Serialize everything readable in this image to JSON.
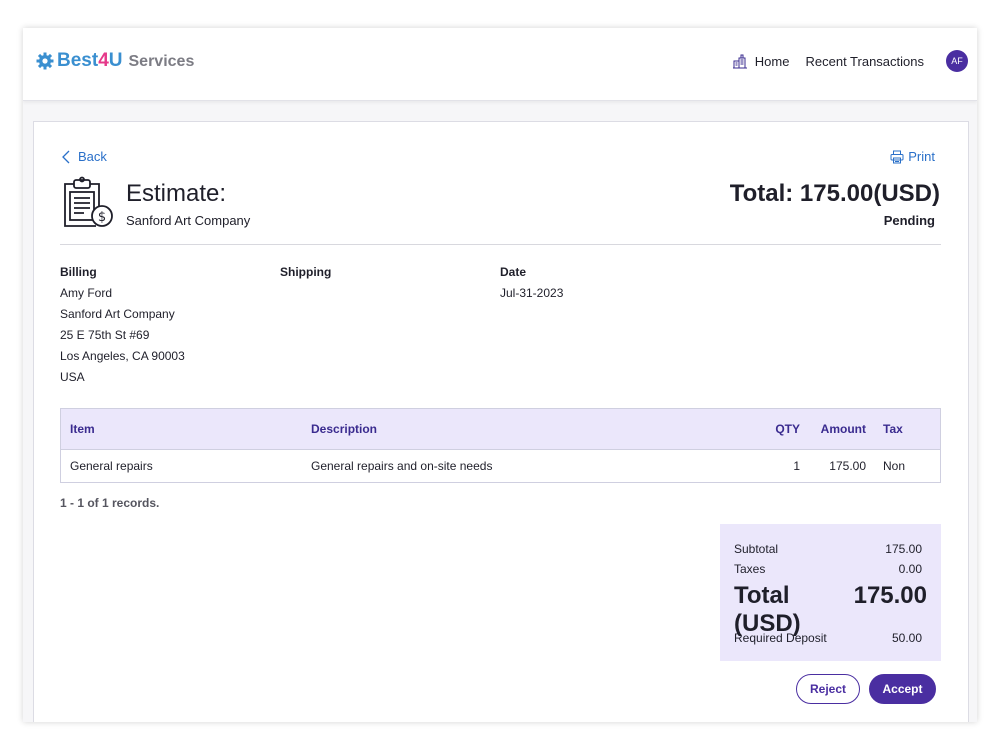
{
  "brand": {
    "best": "Best",
    "four": "4",
    "u": "U",
    "services": "Services"
  },
  "nav": {
    "home": "Home",
    "recent": "Recent Transactions",
    "avatar_initials": "AF"
  },
  "actions": {
    "back": "Back",
    "print": "Print"
  },
  "estimate": {
    "title": "Estimate:",
    "company": "Sanford Art Company",
    "total_label": "Total: 175.00(USD)",
    "status": "Pending"
  },
  "billing": {
    "heading": "Billing",
    "lines": [
      "Amy Ford",
      "Sanford Art Company",
      "25 E 75th St #69",
      "Los Angeles, CA 90003",
      "USA"
    ]
  },
  "shipping": {
    "heading": "Shipping"
  },
  "date": {
    "heading": "Date",
    "value": "Jul-31-2023"
  },
  "table": {
    "headers": {
      "item": "Item",
      "description": "Description",
      "qty": "QTY",
      "amount": "Amount",
      "tax": "Tax"
    },
    "rows": [
      {
        "item": "General repairs",
        "description": "General repairs and on-site needs",
        "qty": "1",
        "amount": "175.00",
        "tax": "Non"
      }
    ],
    "records": "1 - 1 of 1 records."
  },
  "summary": {
    "subtotal_label": "Subtotal",
    "subtotal": "175.00",
    "taxes_label": "Taxes",
    "taxes": "0.00",
    "total_label": "Total (USD)",
    "total": "175.00",
    "deposit_label": "Required Deposit",
    "deposit": "50.00"
  },
  "buttons": {
    "reject": "Reject",
    "accept": "Accept"
  },
  "colors": {
    "accent": "#4a2ea1",
    "link": "#2a70c9",
    "table_header_bg": "#ebe7fb",
    "brand_blue": "#3a8fd0",
    "brand_pink": "#e5398a"
  },
  "icons": {
    "brand": "gear-icon",
    "home": "building-icon",
    "back": "chevron-left-icon",
    "print": "printer-icon",
    "estimate": "clipboard-dollar-icon"
  }
}
